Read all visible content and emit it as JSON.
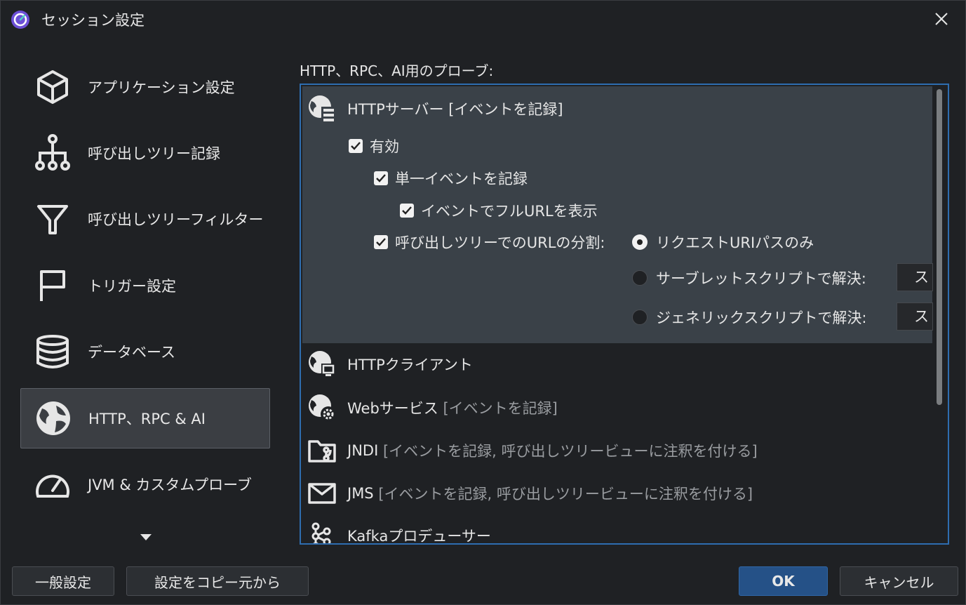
{
  "window": {
    "title": "セッション設定"
  },
  "sidebar": {
    "items": [
      {
        "label": "アプリケーション設定",
        "icon": "cube-icon"
      },
      {
        "label": "呼び出しツリー記録",
        "icon": "tree-icon"
      },
      {
        "label": "呼び出しツリーフィルター",
        "icon": "filter-icon"
      },
      {
        "label": "トリガー設定",
        "icon": "flag-icon"
      },
      {
        "label": "データベース",
        "icon": "database-icon"
      },
      {
        "label": "HTTP、RPC & AI",
        "icon": "globe-icon",
        "active": true
      },
      {
        "label": "JVM & カスタムプローブ",
        "icon": "gauge-icon"
      }
    ]
  },
  "main": {
    "section_label": "HTTP、RPC、AI用のプローブ:",
    "probes": [
      {
        "name": "HTTPサーバー",
        "detail": "[イベントを記録]",
        "icon": "http-server-icon",
        "expanded": true
      },
      {
        "name": "HTTPクライアント",
        "detail": "",
        "icon": "http-client-icon"
      },
      {
        "name": "Webサービス",
        "detail": "[イベントを記録]",
        "icon": "web-service-icon"
      },
      {
        "name": "JNDI",
        "detail": "[イベントを記録, 呼び出しツリービューに注釈を付ける]",
        "icon": "jndi-folder-icon"
      },
      {
        "name": "JMS",
        "detail": "[イベントを記録, 呼び出しツリービューに注釈を付ける]",
        "icon": "mail-icon"
      },
      {
        "name": "Kafkaプロデューサー",
        "detail": "",
        "icon": "kafka-icon"
      }
    ],
    "http_server": {
      "enabled": {
        "label": "有効",
        "checked": true
      },
      "single_event": {
        "label": "単一イベントを記録",
        "checked": true
      },
      "full_url": {
        "label": "イベントでフルURLを表示",
        "checked": true
      },
      "url_split": {
        "label": "呼び出しツリーでのURLの分割:",
        "checked": true
      },
      "radio_options": [
        {
          "label": "リクエストURIパスのみ",
          "selected": true
        },
        {
          "label": "サーブレットスクリプトで解決:",
          "selected": false,
          "field": "ス"
        },
        {
          "label": "ジェネリックスクリプトで解決:",
          "selected": false,
          "field": "ス"
        }
      ]
    }
  },
  "buttons": {
    "general": "一般設定",
    "copy_from": "設定をコピー元から",
    "ok": "OK",
    "cancel": "キャンセル"
  },
  "colors": {
    "accent": "#2e6db0",
    "ok_button": "#255187",
    "selected_bg": "#3a4148"
  }
}
